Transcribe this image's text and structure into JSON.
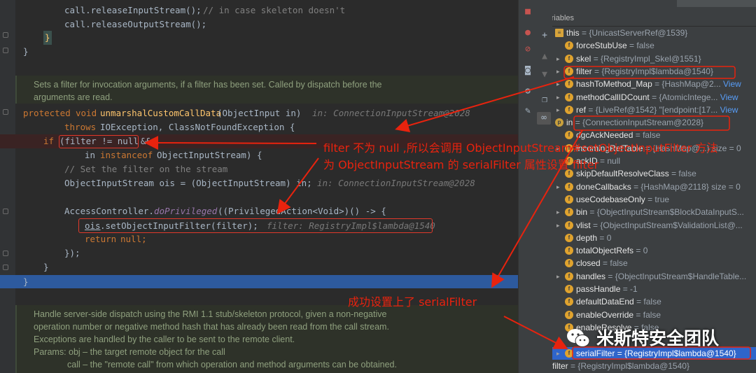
{
  "code": {
    "line_release_in": "call.releaseInputStream();",
    "line_release_in_comment": "// in case skeleton doesn't",
    "line_release_out": "call.releaseOutputStream();",
    "close_brace_yellow": "}",
    "close_brace": "}",
    "doc1": [
      "Sets a filter for invocation arguments, if a filter has been set. Called by dispatch before the",
      "arguments are read."
    ],
    "sig_protected": "protected",
    "sig_void": "void",
    "sig_name": "unmarshalCustomCallData",
    "sig_params": "(ObjectInput in)",
    "sig_hint": "in: ConnectionInputStream@2028",
    "throws_kw": "throws",
    "throws_rest": "IOException, ClassNotFoundException {",
    "if_kw": "if",
    "if_cond": "(filter != null",
    "if_and": "&&",
    "instanceof_in": "in",
    "instanceof_kw": "instanceof",
    "instanceof_rest": "ObjectInputStream) {",
    "comment_set": "// Set the filter on the stream",
    "ois_decl": "ObjectInputStream ois = (ObjectInputStream) in;",
    "ois_hint": "in: ConnectionInputStream@2028",
    "ac_line_start": "AccessController.",
    "ac_method": "doPrivileged",
    "ac_line_rest": "((PrivilegedAction<Void>)() -> {",
    "set_filter_ois": "ois",
    "set_filter_rest": ".setObjectInputFilter(filter);",
    "set_filter_hint": "filter: RegistryImpl$lambda@1540",
    "return_kw": "return",
    "return_rest": "null;",
    "close_lambda": "});",
    "close_if": "}",
    "close_method": "}",
    "doc2": [
      "Handle server-side dispatch using the RMI 1.1 stub/skeleton protocol, given a non-negative",
      "operation number or negative method hash that has already been read from the call stream.",
      "Exceptions are handled by the caller to be sent to the remote client."
    ],
    "doc2_params": "Params: obj – the target remote object for the call",
    "doc2_call": "call – the \"remote call\" from which operation and method arguments can be obtained."
  },
  "debugger": {
    "title": "Variables",
    "vars": [
      {
        "name": "this",
        "value": "= {UnicastServerRef@1539}",
        "expand": "v",
        "kind": "this"
      },
      {
        "name": "forceStubUse",
        "value": "= false",
        "expand": "",
        "kind": "f"
      },
      {
        "name": "skel",
        "value": "= {RegistryImpl_Skel@1551}",
        "expand": ">",
        "kind": "f"
      },
      {
        "name": "filter",
        "value": "= {RegistryImpl$lambda@1540}",
        "expand": ">",
        "kind": "f"
      },
      {
        "name": "hashToMethod_Map",
        "value": "= {HashMap@2...",
        "expand": ">",
        "kind": "f",
        "link": "View"
      },
      {
        "name": "methodCallIDCount",
        "value": "= {AtomicIntege...",
        "expand": ">",
        "kind": "f",
        "link": "View"
      },
      {
        "name": "ref",
        "value": "= {LiveRef@1542} \"[endpoint:[17...",
        "expand": ">",
        "kind": "f",
        "link": "View"
      },
      {
        "name": "in",
        "value": "= {ConnectionInputStream@2028}",
        "expand": "v",
        "kind": "p"
      },
      {
        "name": "dgcAckNeeded",
        "value": "= false",
        "expand": "",
        "kind": "f"
      },
      {
        "name": "incomingRefTable",
        "value": "= {HashMap@...} size = 0",
        "expand": ">",
        "kind": "f"
      },
      {
        "name": "ackID",
        "value": "= null",
        "expand": "",
        "kind": "f"
      },
      {
        "name": "skipDefaultResolveClass",
        "value": "= false",
        "expand": "",
        "kind": "f"
      },
      {
        "name": "doneCallbacks",
        "value": "= {HashMap@2118} size = 0",
        "expand": ">",
        "kind": "f"
      },
      {
        "name": "useCodebaseOnly",
        "value": "= true",
        "expand": "",
        "kind": "f"
      },
      {
        "name": "bin",
        "value": "= {ObjectInputStream$BlockDataInputS...",
        "expand": ">",
        "kind": "f"
      },
      {
        "name": "vlist",
        "value": "= {ObjectInputStream$ValidationList@...",
        "expand": ">",
        "kind": "f"
      },
      {
        "name": "depth",
        "value": "= 0",
        "expand": "",
        "kind": "f"
      },
      {
        "name": "totalObjectRefs",
        "value": "= 0",
        "expand": "",
        "kind": "f"
      },
      {
        "name": "closed",
        "value": "= false",
        "expand": "",
        "kind": "f"
      },
      {
        "name": "handles",
        "value": "= {ObjectInputStream$HandleTable...",
        "expand": ">",
        "kind": "f"
      },
      {
        "name": "passHandle",
        "value": "= -1",
        "expand": "",
        "kind": "f"
      },
      {
        "name": "defaultDataEnd",
        "value": "= false",
        "expand": "",
        "kind": "f"
      },
      {
        "name": "enableOverride",
        "value": "= false",
        "expand": "",
        "kind": "f"
      },
      {
        "name": "enableResolve",
        "value": "= false",
        "expand": "",
        "kind": "f"
      },
      {
        "name": "",
        "value": "",
        "expand": "",
        "kind": "f"
      },
      {
        "name": "serialFilter",
        "value": "= {RegistryImpl$lambda@1540}",
        "expand": ">",
        "kind": "f",
        "selected": true
      },
      {
        "name": "filter",
        "value": "= {RegistryImpl$lambda@1540}",
        "expand": ">",
        "kind": "oo"
      }
    ]
  },
  "annotations": {
    "line1": "filter 不为 null ,所以会调用 ObjectInputStream#setObjectInputFilter 方法",
    "line2": "为 ObjectInputStream 的 serialFilter 属性设置 filter",
    "success": "成功设置上了 serialFilter",
    "watermark": "米斯特安全团队"
  },
  "colors": {
    "annotation": "#e8230e",
    "selection": "#2f65ca",
    "editor_bg": "#2b2b2b"
  }
}
